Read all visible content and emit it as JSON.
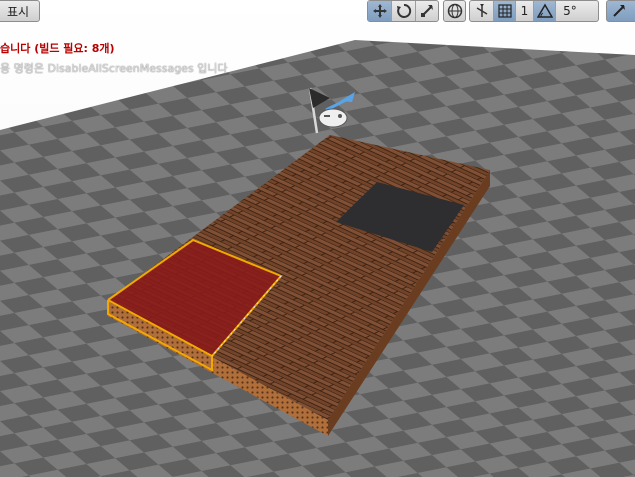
{
  "toolbar": {
    "show_label": "표시",
    "snap_value": "5°",
    "scale_snap_value": "1",
    "icons": [
      "move-icon",
      "rotate-icon",
      "scale-icon",
      "globe-icon",
      "surface-snap-icon",
      "grid-snap-icon",
      "rotation-snap-icon",
      "scale-snap-icon",
      "camera-speed-icon"
    ]
  },
  "messages": {
    "error": "습니다 (빌드 필요: 8개)",
    "info": "용 명령은 DisableAllScreenMessages 입니다"
  },
  "colors": {
    "floor_light": "#7a7a7a",
    "floor_dark": "#5d5d5d",
    "wood": "#7a4a2e",
    "selection": "#f2a800",
    "dark_panel": "#2e2e30",
    "red_highlight": "#8b1a1a",
    "error_text": "#b80000"
  }
}
